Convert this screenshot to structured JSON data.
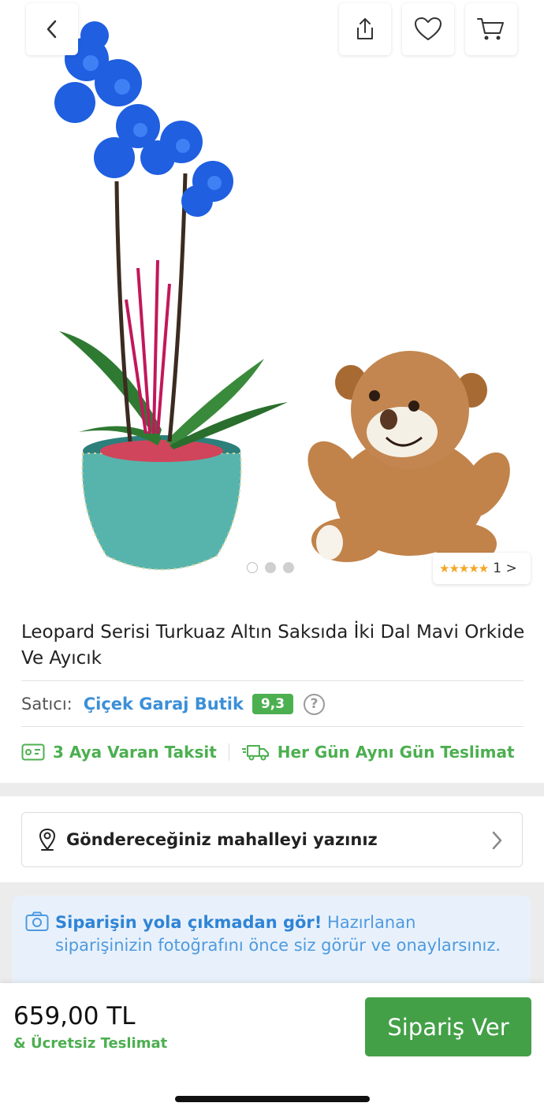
{
  "product": {
    "title": "Leopard Serisi Turkuaz Altın Saksıda İki Dal Mavi Orkide Ve Ayıcık",
    "image_count": 3,
    "active_image": 1,
    "rating_stars": 5,
    "review_count": "1 >"
  },
  "icons": {
    "back": "chevron-left-icon",
    "share": "share-icon",
    "favorite": "heart-icon",
    "cart": "cart-icon",
    "help": "question-circle-icon",
    "installment": "card-icon",
    "delivery": "delivery-truck-icon",
    "location": "location-pin-icon",
    "camera": "camera-icon"
  },
  "seller": {
    "label": "Satıcı:",
    "name": "Çiçek Garaj Butik",
    "score": "9,3",
    "help": "?"
  },
  "features": [
    {
      "label": "3 Aya Varan Taksit"
    },
    {
      "label": "Her Gün Aynı Gün Teslimat"
    }
  ],
  "address": {
    "placeholder": "Göndereceğiniz mahalleyi yazınız"
  },
  "photo_notice": {
    "bold": "Siparişin yola çıkmadan gör!",
    "text": " Hazırlanan siparişinizin fotoğrafını önce siz görür ve onaylarsınız."
  },
  "bottom": {
    "price": "659,00 TL",
    "delivery": "& Ücretsiz Teslimat",
    "order_button": "Sipariş Ver"
  },
  "colors": {
    "accent_green": "#43a047",
    "link_blue": "#3b8fd8",
    "star": "#f5a623"
  }
}
